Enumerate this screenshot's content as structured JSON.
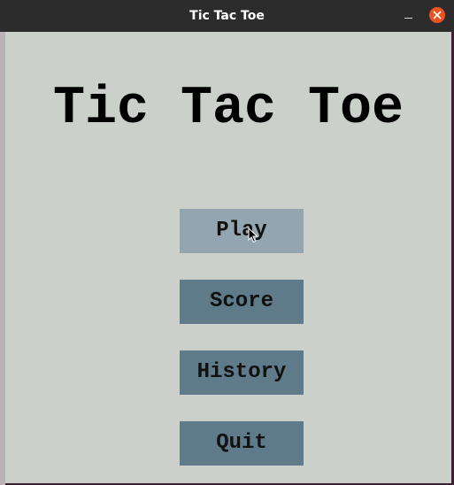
{
  "window": {
    "title": "Tic Tac Toe"
  },
  "main": {
    "heading": "Tic Tac Toe",
    "buttons": {
      "play": "Play",
      "score": "Score",
      "history": "History",
      "quit": "Quit"
    }
  },
  "colors": {
    "background": "#cbd0cb",
    "button": "#5f7b8a",
    "button_hover": "#93a6b0",
    "titlebar": "#2c2c2c",
    "close": "#e95420"
  },
  "icons": {
    "minimize": "minimize-icon",
    "close": "close-icon",
    "cursor": "mouse-pointer-icon"
  }
}
